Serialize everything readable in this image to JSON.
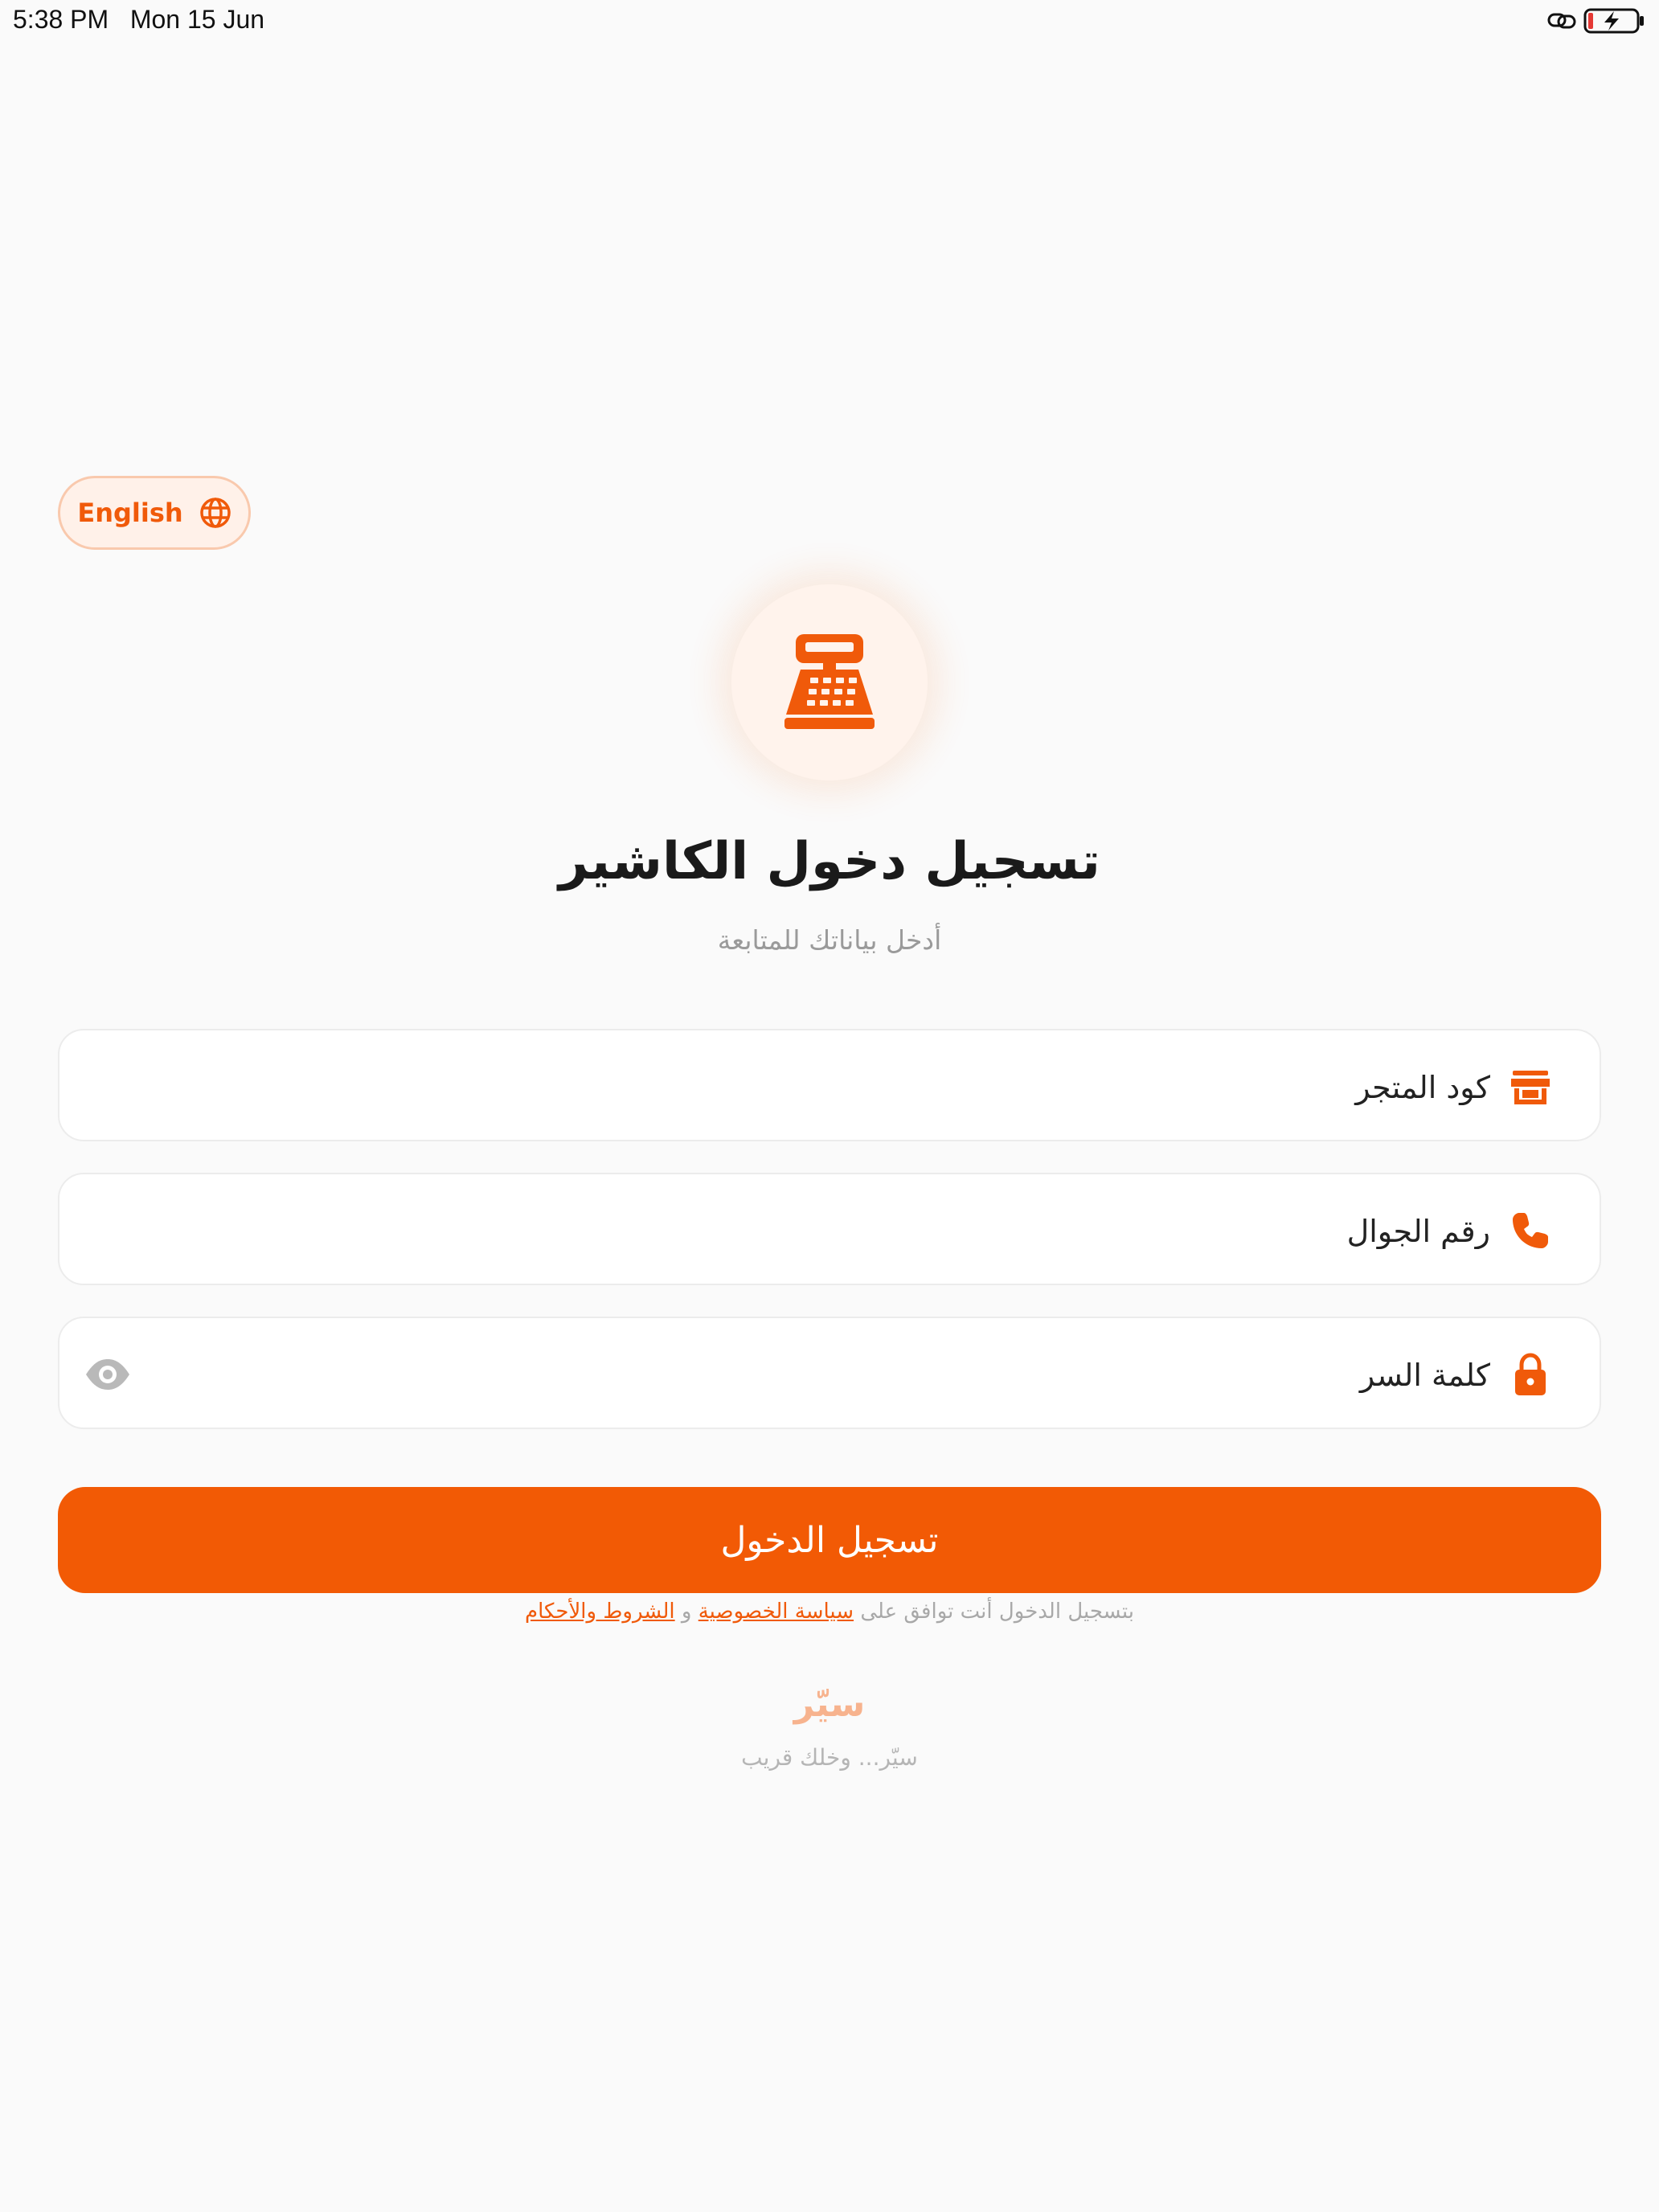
{
  "status_bar": {
    "time": "5:38 PM",
    "date": "Mon 15 Jun",
    "icons": [
      "link-icon",
      "battery-charging-icon"
    ]
  },
  "language_button": {
    "label": "English",
    "icon": "globe-icon"
  },
  "logo": {
    "icon": "cash-register-icon"
  },
  "header": {
    "title": "تسجيل دخول الكاشير",
    "subtitle": "أدخل بياناتك للمتابعة"
  },
  "form": {
    "store_code": {
      "placeholder": "كود المتجر",
      "value": "",
      "icon": "store-icon"
    },
    "phone": {
      "placeholder": "رقم الجوال",
      "value": "",
      "icon": "phone-icon"
    },
    "password": {
      "placeholder": "كلمة السر",
      "value": "",
      "icon": "lock-icon",
      "toggle_icon": "eye-icon"
    }
  },
  "login_button": {
    "label": "تسجيل الدخول"
  },
  "terms": {
    "prefix": "بتسجيل الدخول أنت توافق على",
    "privacy_link": "سياسة الخصوصية",
    "conjunction": "و",
    "terms_link": "الشروط والأحكام"
  },
  "footer": {
    "brand": "سيّر",
    "tagline": "سيّر... وخلك قريب"
  },
  "colors": {
    "accent": "#f25a05",
    "background": "#fafafa",
    "muted_text": "#9a9a9a"
  }
}
